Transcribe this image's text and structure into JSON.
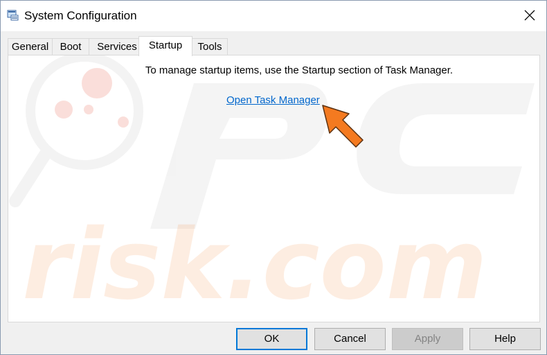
{
  "window": {
    "title": "System Configuration"
  },
  "tabs": [
    {
      "label": "General"
    },
    {
      "label": "Boot"
    },
    {
      "label": "Services"
    },
    {
      "label": "Startup"
    },
    {
      "label": "Tools"
    }
  ],
  "active_tab": "Startup",
  "startup": {
    "instruction": "To manage startup items, use the Startup section of Task Manager.",
    "link_label": "Open Task Manager"
  },
  "buttons": {
    "ok": "OK",
    "cancel": "Cancel",
    "apply": "Apply",
    "help": "Help"
  },
  "watermark": {
    "text": "PC risk.com",
    "color": "#f2c4b8"
  },
  "annotation": {
    "arrow_color": "#f47a20"
  },
  "colors": {
    "link": "#0066cc",
    "focus_border": "#0078d7"
  }
}
